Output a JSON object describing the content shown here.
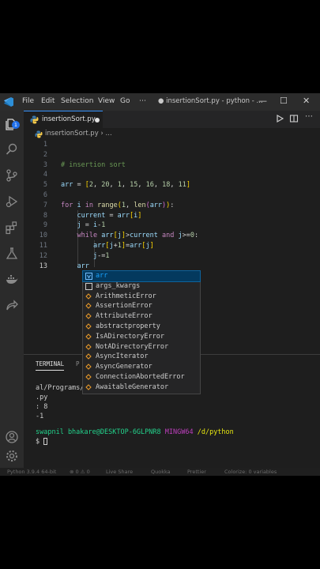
{
  "titlebar": {
    "menus": [
      "File",
      "Edit",
      "Selection",
      "View",
      "Go",
      "⋯"
    ],
    "window_title": "● insertionSort.py - python - ...",
    "controls": [
      "—",
      "☐",
      "✕"
    ]
  },
  "activity": {
    "badge": "1"
  },
  "tab": {
    "label": "insertionSort.py"
  },
  "breadcrumb": {
    "label": "insertionSort.py › ..."
  },
  "code": {
    "line_numbers": [
      "1",
      "2",
      "3",
      "4",
      "5",
      "6",
      "7",
      "8",
      "9",
      "10",
      "11",
      "12",
      "13"
    ],
    "comment": "# insertion sort",
    "arr_values": [
      "2",
      "20",
      "1",
      "15",
      "16",
      "18",
      "11"
    ]
  },
  "suggest": {
    "items": [
      "arr",
      "args_kwargs",
      "ArithmeticError",
      "AssertionError",
      "AttributeError",
      "abstractproperty",
      "IsADirectoryError",
      "NotADirectoryError",
      "AsyncIterator",
      "AsyncGenerator",
      "ConnectionAbortedError",
      "AwaitableGenerator"
    ]
  },
  "panel": {
    "tabs": [
      "TERMINAL",
      "P"
    ],
    "lines": [
      "al/Programs/",
      ".py",
      ": 8",
      "-1"
    ],
    "prompt_user": "swapnil bhakare@DESKTOP-6GLPNR8",
    "prompt_shell": "MINGW64",
    "prompt_path": "/d/python",
    "prompt_symbol": "$"
  },
  "status": {
    "python": "Python 3.9.4 64-bit",
    "problems": "⊗ 0 ⚠ 0",
    "live_share": "Live Share",
    "quokka": "Quokka",
    "prettier": "Prettier",
    "colorize": "Colorize: 0 variables"
  }
}
